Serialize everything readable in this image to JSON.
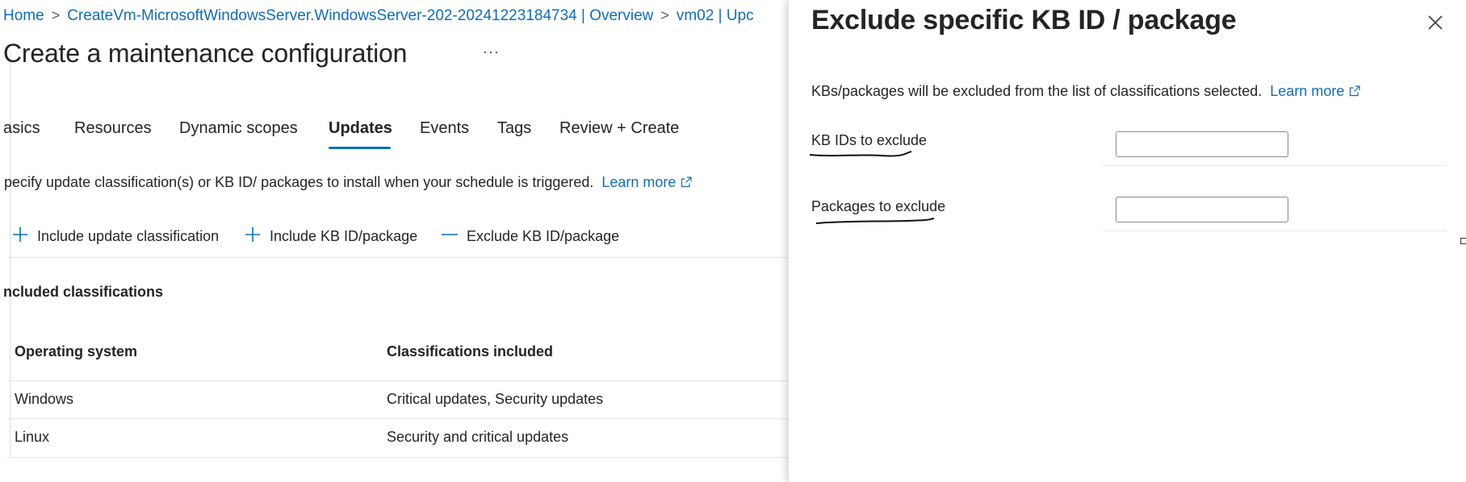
{
  "breadcrumb": {
    "items": [
      "Home",
      "CreateVm-MicrosoftWindowsServer.WindowsServer-202-20241223184734 | Overview",
      "vm02 | Upc"
    ],
    "separator": ">"
  },
  "page": {
    "title": "Create a maintenance configuration",
    "more_label": "···"
  },
  "tabs": {
    "basics": "asics",
    "resources": "Resources",
    "dynamic_scopes": "Dynamic scopes",
    "updates": "Updates",
    "events": "Events",
    "tags": "Tags",
    "review": "Review + Create",
    "active": "Updates"
  },
  "description": {
    "text": "pecify update classification(s) or KB ID/ packages to install when your schedule is triggered.",
    "link": "Learn more"
  },
  "commands": {
    "include_classification": "Include update classification",
    "include_kb": "Include KB ID/package",
    "exclude_kb": "Exclude KB ID/package"
  },
  "included": {
    "title": "ncluded classifications",
    "columns": [
      "Operating system",
      "Classifications included"
    ],
    "rows": [
      {
        "os": "Windows",
        "classifications": "Critical updates, Security updates"
      },
      {
        "os": "Linux",
        "classifications": "Security and critical updates"
      }
    ]
  },
  "panel": {
    "title": "Exclude specific KB ID / package",
    "description": "KBs/packages will be excluded from the list of classifications selected.",
    "learn_more": "Learn more",
    "kb_label": "KB IDs to exclude",
    "kb_value": "",
    "packages_label": "Packages to exclude",
    "packages_value": ""
  },
  "colors": {
    "accent": "#0f6cbd",
    "text": "#242424"
  },
  "icons": [
    "chevron-right-icon",
    "more-icon",
    "external-link-icon",
    "plus-icon",
    "minus-icon",
    "close-icon"
  ]
}
